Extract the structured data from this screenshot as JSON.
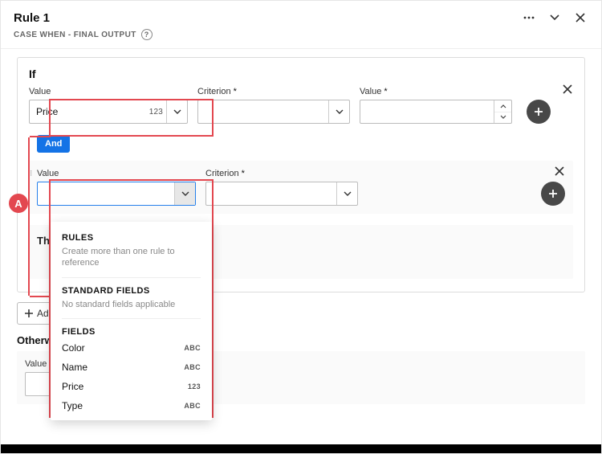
{
  "header": {
    "title": "Rule 1",
    "subtitle": "CASE WHEN - FINAL OUTPUT"
  },
  "if": {
    "title": "If",
    "row1": {
      "value_label": "Value",
      "value_text": "Price",
      "value_type": "123",
      "criterion_label": "Criterion",
      "value2_label": "Value"
    },
    "and_label": "And",
    "row2": {
      "value_label": "Value",
      "criterion_label": "Criterion"
    },
    "then_title": "Then"
  },
  "elseBtn": {
    "label": "Add Else If"
  },
  "other": {
    "title": "Otherwise",
    "value_label": "Value"
  },
  "dropdown": {
    "rules_title": "RULES",
    "rules_desc": "Create more than one rule to reference",
    "std_title": "STANDARD FIELDS",
    "std_desc": "No standard fields applicable",
    "fields_title": "FIELDS",
    "items": [
      {
        "label": "Color",
        "type": "ABC"
      },
      {
        "label": "Name",
        "type": "ABC"
      },
      {
        "label": "Price",
        "type": "123"
      },
      {
        "label": "Type",
        "type": "ABC"
      }
    ]
  },
  "annotation": {
    "badge": "A"
  }
}
